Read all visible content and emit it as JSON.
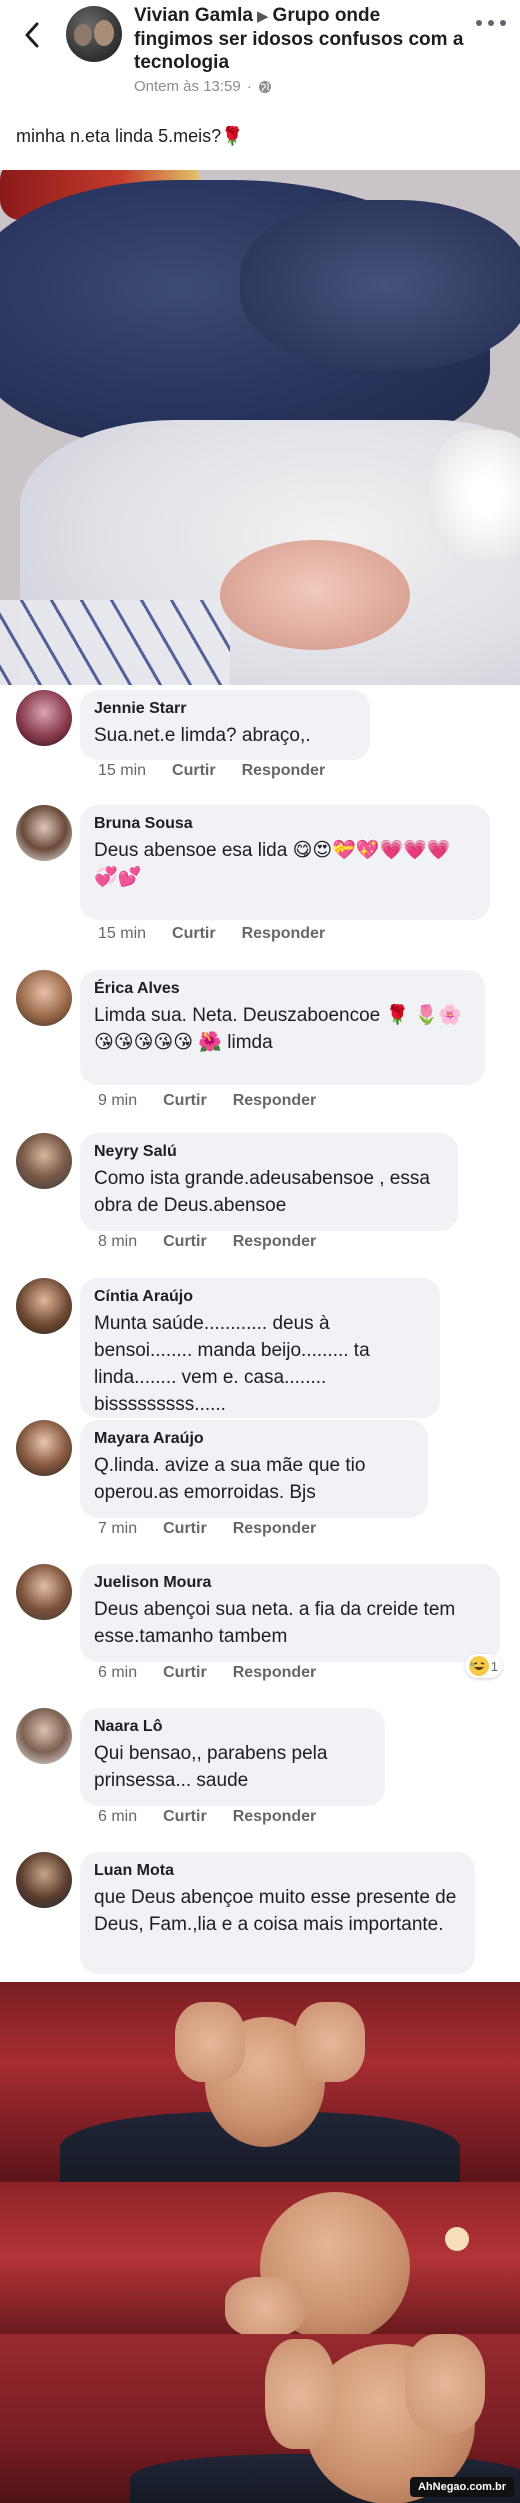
{
  "header": {
    "author": "Vivian Gamla",
    "group": "Grupo onde fingimos ser idosos confusos com a tecnologia",
    "timestamp": "Ontem às 13:59",
    "separator": "·"
  },
  "post": {
    "caption": "minha n.eta linda 5.meis?🌹"
  },
  "comments": [
    {
      "name": "Jennie Starr",
      "text": "Sua.net.e limda? abraço,.",
      "time": "15 min",
      "like": "Curtir",
      "reply": "Responder"
    },
    {
      "name": "Bruna Sousa",
      "text": "Deus abensoe esa lida 😋😍💝💖💗💗💗💞💕",
      "time": "15 min",
      "like": "Curtir",
      "reply": "Responder"
    },
    {
      "name": "Érica Alves",
      "text": "Limda sua. Neta. Deuszaboencoe 🌹 🌷🌸😘😘😘😘😘 🌺 limda",
      "time": "9 min",
      "like": "Curtir",
      "reply": "Responder"
    },
    {
      "name": "Neyry Salú",
      "text": "Como ista grande.adeusabensoe , essa obra de Deus.abensoe",
      "time": "8 min",
      "like": "Curtir",
      "reply": "Responder"
    },
    {
      "name": "Cíntia Araújo",
      "text": "Munta saúde............ deus à bensoi........ manda beijo......... ta linda........ vem e. casa........ bisssssssss......",
      "time": "",
      "like": "",
      "reply": ""
    },
    {
      "name": "Mayara Araújo",
      "text": "Q.linda. avize a sua mãe que tio operou.as emorroidas. Bjs",
      "time": "7 min",
      "like": "Curtir",
      "reply": "Responder"
    },
    {
      "name": "Juelison Moura",
      "text": "Deus abençoi sua neta. a fia da creide tem esse.tamanho tambem",
      "time": "6 min",
      "like": "Curtir",
      "reply": "Responder",
      "reaction_count": "1"
    },
    {
      "name": "Naara Lô",
      "text": "Qui bensao,, parabens pela prinsessa... saude",
      "time": "6 min",
      "like": "Curtir",
      "reply": "Responder"
    },
    {
      "name": "Luan Mota",
      "text": "que Deus abençoe muito esse presente de Deus, Fam.,lia e a coisa mais importante.",
      "time": "",
      "like": "",
      "reply": ""
    }
  ],
  "watermark": "AhNegao.com.br",
  "icons": {
    "back": "back-arrow-icon",
    "globe": "globe-icon",
    "more": "more-options-icon",
    "reaction": "laughing-emoji-icon"
  }
}
